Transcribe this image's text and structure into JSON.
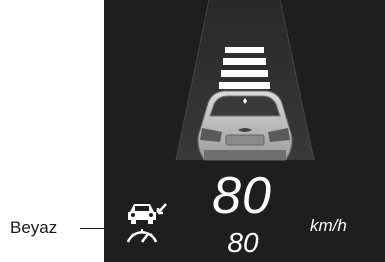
{
  "callout": {
    "label": "Beyaz"
  },
  "display": {
    "current_speed": "80",
    "set_speed": "80",
    "unit": "km/h",
    "icon": "radar-cruise-control-icon",
    "icon_color": "#ffffff",
    "background_color": "#1e1e1e",
    "gap_bars": 4
  }
}
